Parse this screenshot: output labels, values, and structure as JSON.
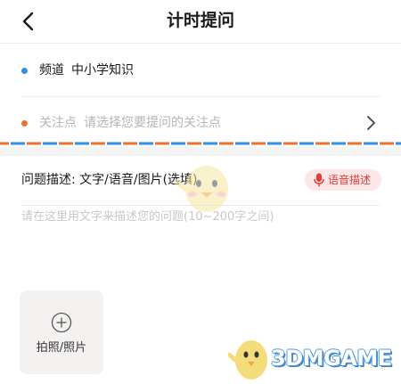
{
  "header": {
    "title": "计时提问",
    "back_icon": "back-arrow-icon"
  },
  "channel_row": {
    "label": "频道",
    "value": "中小学知识",
    "dot_color": "#2f8fe0"
  },
  "focus_row": {
    "label": "关注点",
    "value": "请选择您要提问的关注点",
    "dot_color": "#f0702e",
    "chevron_icon": "chevron-right-icon"
  },
  "divider": {
    "colors": [
      "#f0702e",
      "#2f8fe0"
    ]
  },
  "description": {
    "label": "问题描述: 文字/语音/图片(选填)",
    "voice_button_label": "语音描述",
    "voice_icon": "microphone-icon",
    "input_value": "",
    "input_placeholder": "请在这里用文字来描述您的问题(10~200字之间)"
  },
  "photo": {
    "label": "拍照/照片",
    "icon": "plus-circle-icon"
  },
  "watermark": {
    "text": "3DMGAME"
  },
  "colors": {
    "accent_red": "#e63b3b",
    "accent_red_bg": "#fde6e6"
  }
}
